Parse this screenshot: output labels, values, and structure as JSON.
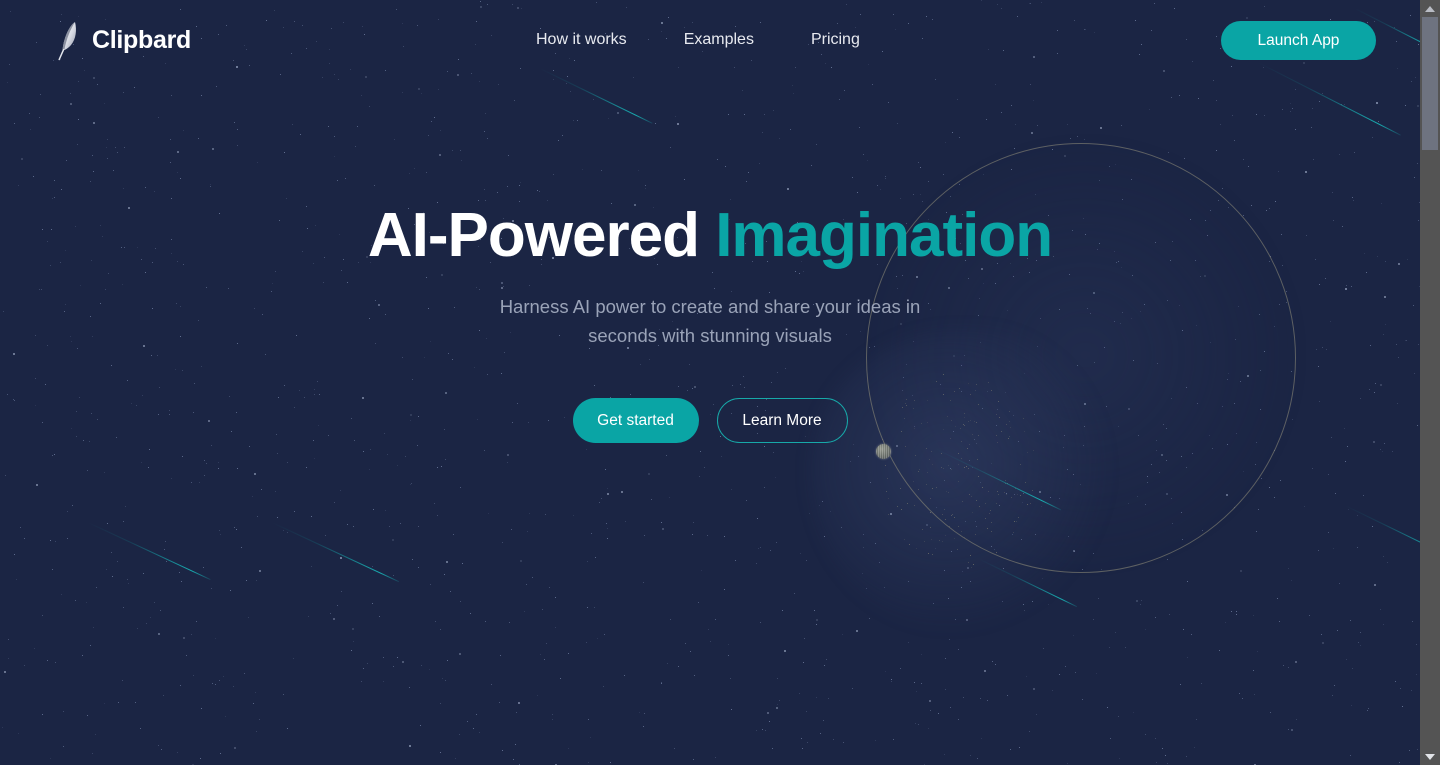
{
  "page": {
    "background_color": "#1b2544",
    "accent_color": "#0aa5a5",
    "heading_color": "#ffffff",
    "body_text_color": "#9aa3b8"
  },
  "header": {
    "brand": {
      "name": "Clipbard",
      "icon": "feather-quill-icon"
    },
    "nav": [
      {
        "label": "How it works"
      },
      {
        "label": "Examples"
      },
      {
        "label": "Pricing"
      }
    ],
    "cta": {
      "label": "Launch App"
    }
  },
  "hero": {
    "headline": {
      "plain": "AI-Powered",
      "accent": "Imagination"
    },
    "subheadline": "Harness AI power to create and share your ideas in seconds with stunning visuals",
    "buttons": [
      {
        "label": "Get started",
        "style": "primary"
      },
      {
        "label": "Learn More",
        "style": "outline"
      }
    ]
  },
  "decorations": {
    "orbit_circle": "orbit-ring",
    "orbit_node": "orbit-node-sphere",
    "nebula": "nebula-glow",
    "starfield": "starfield",
    "shooting_stars": 5
  },
  "scrollbar": {
    "up_arrow": "scroll-up-arrow",
    "down_arrow": "scroll-down-arrow",
    "thumb": "scroll-thumb"
  }
}
